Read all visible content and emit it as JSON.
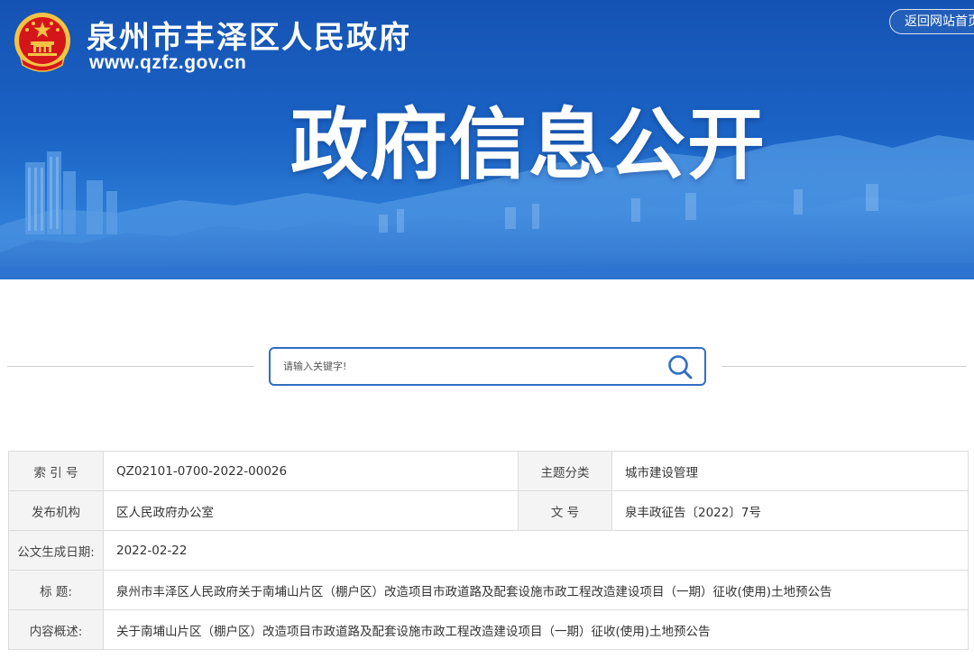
{
  "header": {
    "site_name": "泉州市丰泽区人民政府",
    "site_url": "www.qzfz.gov.cn",
    "home_link": "返回网站首页",
    "banner_title": "政府信息公开"
  },
  "search": {
    "placeholder": "请输入关键字!"
  },
  "info": {
    "index_label": "索 引 号",
    "index_value": "QZ02101-0700-2022-00026",
    "topic_label": "主题分类",
    "topic_value": "城市建设管理",
    "publisher_label": "发布机构",
    "publisher_value": "区人民政府办公室",
    "doc_no_label": "文  号",
    "doc_no_value": "泉丰政征告〔2022〕7号",
    "date_label": "公文生成日期:",
    "date_value": "2022-02-22",
    "title_label": "标  题:",
    "title_value": "泉州市丰泽区人民政府关于南埔山片区（棚户区）改造项目市政道路及配套设施市政工程改造建设项目（一期）征收(使用)土地预公告",
    "summary_label": "内容概述:",
    "summary_value": "关于南埔山片区（棚户区）改造项目市政道路及配套设施市政工程改造建设项目（一期）征收(使用)土地预公告"
  },
  "colors": {
    "banner_blue": "#1a5fc2",
    "accent_blue": "#2f6fc4",
    "emblem_red": "#d4161b",
    "emblem_gold": "#f3c443"
  },
  "icons": {
    "emblem": "national-emblem-icon",
    "search": "search-icon"
  }
}
